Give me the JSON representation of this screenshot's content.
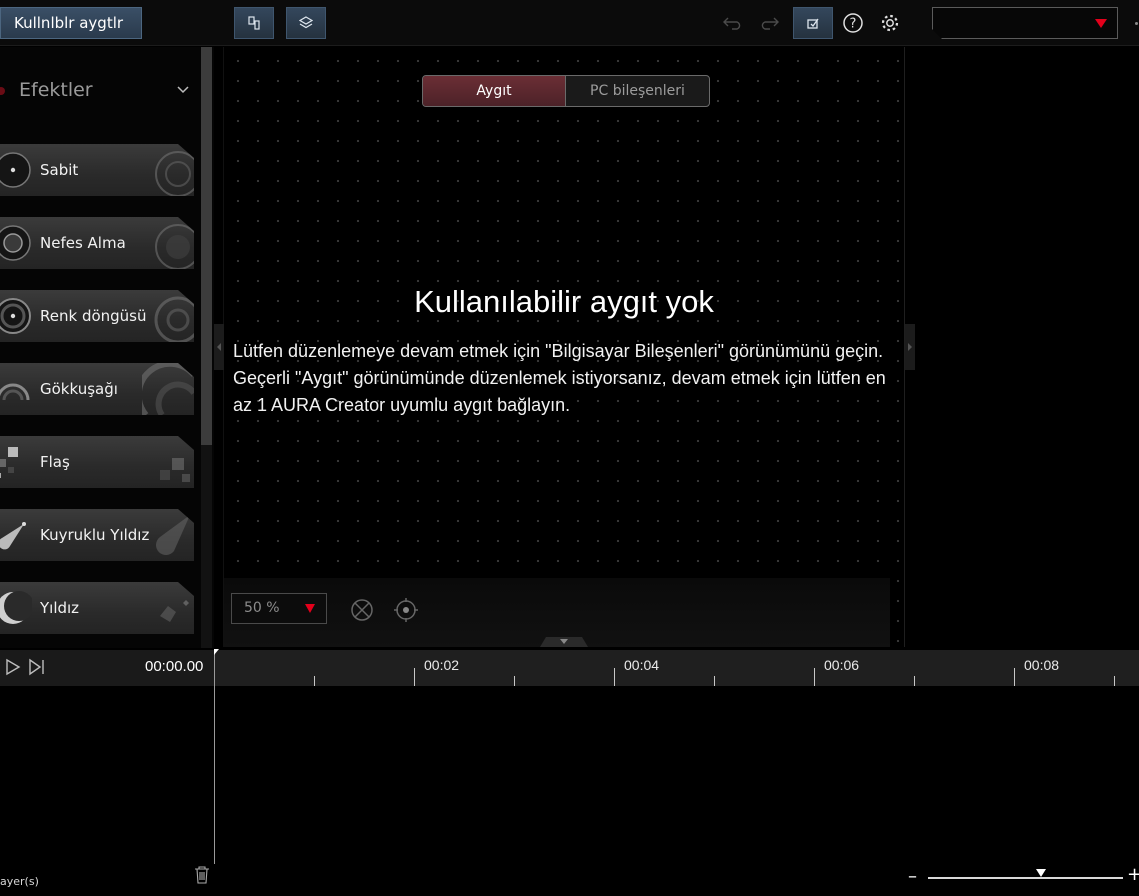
{
  "topbar": {
    "devices_button": "Kullnlblr aygtlr",
    "icons": [
      "device-layout-icon",
      "layers-icon",
      "undo-icon",
      "redo-icon",
      "save-icon",
      "help-icon",
      "settings-icon"
    ],
    "profile_value": "",
    "accent": "#e3001b"
  },
  "effects_panel": {
    "title": "Efektler",
    "items": [
      {
        "label": "Sabit",
        "icon": "static-icon"
      },
      {
        "label": "Nefes Alma",
        "icon": "breathing-icon"
      },
      {
        "label": "Renk döngüsü",
        "icon": "color-cycle-icon"
      },
      {
        "label": "Gökkuşağı",
        "icon": "rainbow-icon"
      },
      {
        "label": "Flaş",
        "icon": "flash-icon"
      },
      {
        "label": "Kuyruklu Yıldız",
        "icon": "comet-icon"
      },
      {
        "label": "Yıldız",
        "icon": "star-icon"
      }
    ]
  },
  "view_toggle": {
    "device": "Aygıt",
    "pc_components": "PC bileşenleri",
    "selected": "Aygıt"
  },
  "message": {
    "title": "Kullanılabilir aygıt yok",
    "body": "Lütfen düzenlemeye devam etmek için \"Bilgisayar Bileşenleri\" görünümünü geçin. Geçerli \"Aygıt\" görünümünde düzenlemek istiyorsanız, devam etmek için lütfen en az 1 AURA Creator uyumlu aygıt bağlayın."
  },
  "canvas_footer": {
    "zoom": "50 %"
  },
  "timeline": {
    "current_time": "00:00.00",
    "labels": [
      "00:02",
      "00:04",
      "00:06",
      "00:08"
    ],
    "layers_label": "ayer(s)"
  }
}
